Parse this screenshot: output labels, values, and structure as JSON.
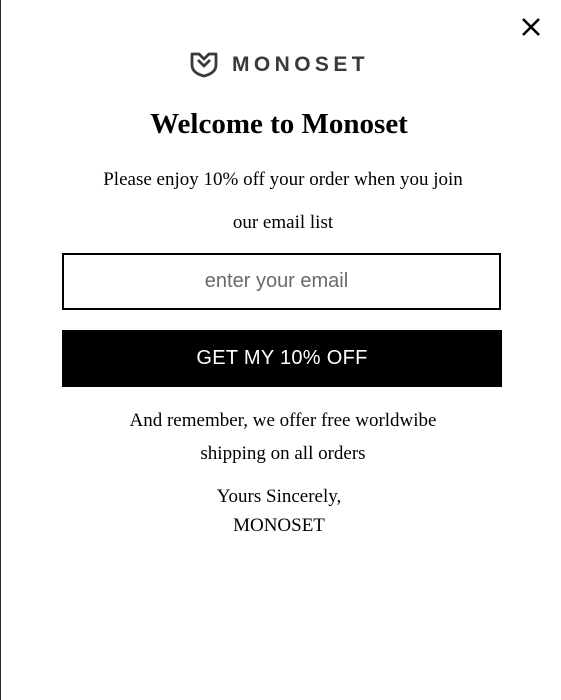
{
  "popup": {
    "close_icon": "close-icon",
    "logo": {
      "icon": "monoset-shield-icon",
      "text": "MONOSET"
    },
    "title": "Welcome to Monoset",
    "subtitle_line1": "Please enjoy 10% off your order when you join",
    "subtitle_line2": "our email list",
    "email_input": {
      "placeholder": "enter your email",
      "value": ""
    },
    "submit_label": "GET MY 10% OFF",
    "note_line1": "And remember, we offer free worldwibe",
    "note_line2": "shipping on all orders",
    "signoff_line1": "Yours Sincerely,",
    "signoff_line2": "MONOSET"
  },
  "colors": {
    "button_bg": "#000000",
    "button_text": "#ffffff",
    "logo_text": "#3a3a3a",
    "background": "#ffffff"
  }
}
